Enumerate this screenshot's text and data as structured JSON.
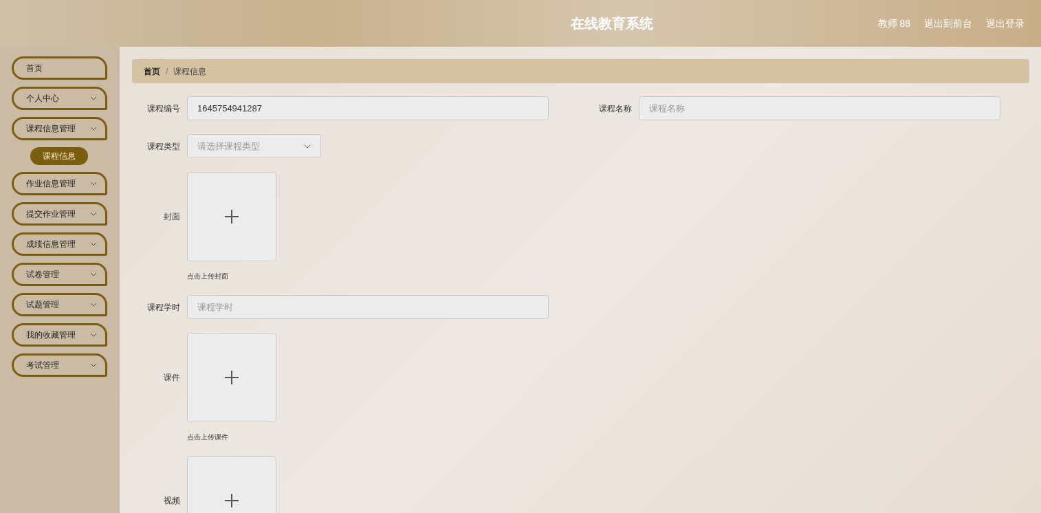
{
  "header": {
    "title": "在线教育系统",
    "user": "教师 88",
    "links": [
      "退出到前台",
      "退出登录"
    ]
  },
  "sidebar": {
    "items": [
      {
        "label": "首页",
        "kind": "link"
      },
      {
        "label": "个人中心",
        "kind": "menu"
      },
      {
        "label": "课程信息管理",
        "kind": "menu",
        "children": [
          {
            "label": "课程信息",
            "selected": true
          }
        ]
      },
      {
        "label": "作业信息管理",
        "kind": "menu"
      },
      {
        "label": "提交作业管理",
        "kind": "menu"
      },
      {
        "label": "成绩信息管理",
        "kind": "menu"
      },
      {
        "label": "试卷管理",
        "kind": "menu"
      },
      {
        "label": "试题管理",
        "kind": "menu"
      },
      {
        "label": "我的收藏管理",
        "kind": "menu"
      },
      {
        "label": "考试管理",
        "kind": "menu"
      }
    ]
  },
  "breadcrumb": {
    "separator": "/",
    "items": [
      "首页",
      "课程信息"
    ]
  },
  "form": {
    "rows": [
      [
        {
          "kind": "text",
          "label": "课程编号",
          "value": "1645754941287"
        },
        {
          "kind": "text",
          "label": "课程名称",
          "placeholder": "课程名称"
        }
      ],
      [
        {
          "kind": "select",
          "label": "课程类型",
          "placeholder": "请选择课程类型"
        }
      ],
      [
        {
          "kind": "upload",
          "label": "封面",
          "hint": "点击上传封面"
        }
      ],
      [
        {
          "kind": "text",
          "label": "课程学时",
          "placeholder": "课程学时"
        }
      ],
      [
        {
          "kind": "upload",
          "label": "课件",
          "hint": "点击上传课件"
        }
      ],
      [
        {
          "kind": "upload",
          "label": "视频"
        }
      ]
    ]
  }
}
